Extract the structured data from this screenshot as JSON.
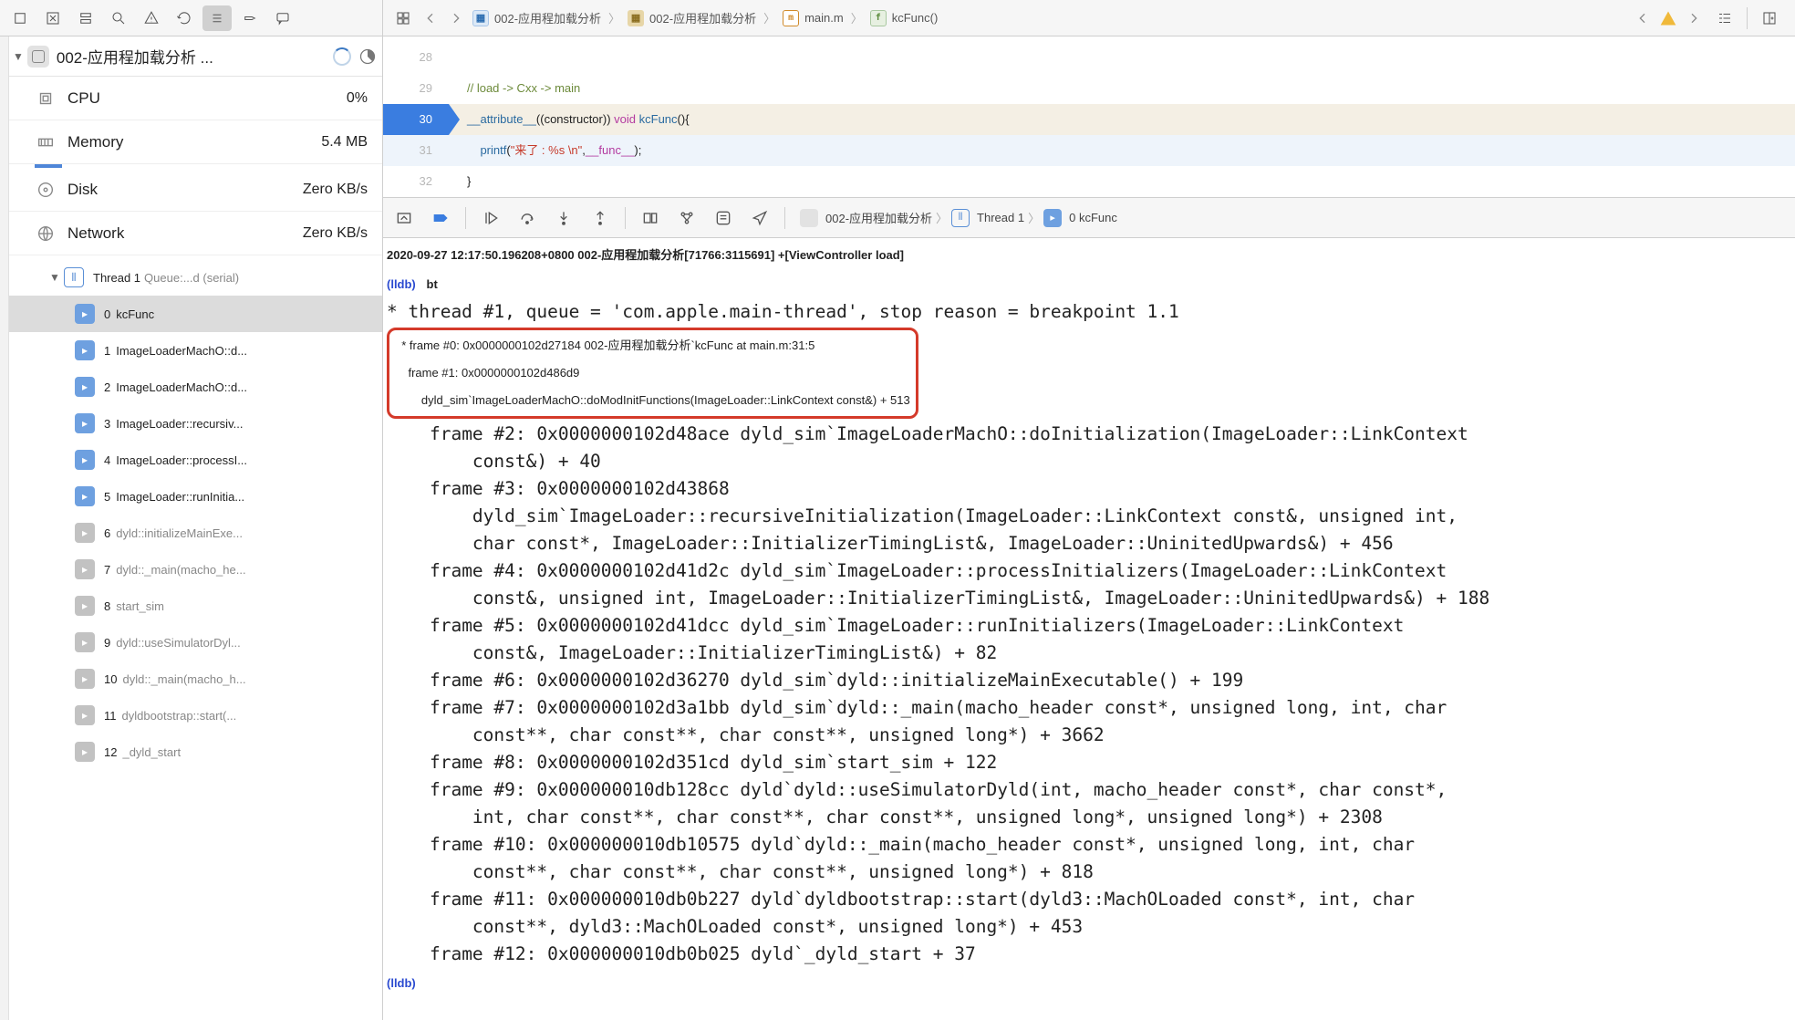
{
  "toolbar_left_icons": [
    "square-icon",
    "x-box-icon",
    "stack-icon",
    "search-icon",
    "warning-icon",
    "refresh-icon",
    "list-icon",
    "tag-icon",
    "chat-icon"
  ],
  "breadcrumbs": [
    {
      "icon": "blue",
      "label": "002-应用程加载分析"
    },
    {
      "icon": "folder",
      "label": "002-应用程加载分析"
    },
    {
      "icon": "m",
      "label": "main.m"
    },
    {
      "icon": "f",
      "label": "kcFunc()"
    }
  ],
  "project": {
    "title": "002-应用程加载分析 ..."
  },
  "metrics": [
    {
      "name": "CPU",
      "value": "0%",
      "icon": "cpu"
    },
    {
      "name": "Memory",
      "value": "5.4 MB",
      "icon": "memory",
      "bar_color": "#4f86d8",
      "bar_pct": 8
    },
    {
      "name": "Disk",
      "value": "Zero KB/s",
      "icon": "disk"
    },
    {
      "name": "Network",
      "value": "Zero KB/s",
      "icon": "network"
    }
  ],
  "thread": {
    "label": "Thread 1",
    "tail": "Queue:...d (serial)"
  },
  "frames": [
    {
      "n": "0",
      "label": "kcFunc",
      "dim": false,
      "selected": true
    },
    {
      "n": "1",
      "label": "ImageLoaderMachO::d...",
      "dim": false
    },
    {
      "n": "2",
      "label": "ImageLoaderMachO::d...",
      "dim": false
    },
    {
      "n": "3",
      "label": "ImageLoader::recursiv...",
      "dim": false
    },
    {
      "n": "4",
      "label": "ImageLoader::processI...",
      "dim": false
    },
    {
      "n": "5",
      "label": "ImageLoader::runInitia...",
      "dim": false
    },
    {
      "n": "6",
      "label": "dyld::initializeMainExe...",
      "dim": true
    },
    {
      "n": "7",
      "label": "dyld::_main(macho_he...",
      "dim": true
    },
    {
      "n": "8",
      "label": "start_sim",
      "dim": true
    },
    {
      "n": "9",
      "label": "dyld::useSimulatorDyl...",
      "dim": true
    },
    {
      "n": "10",
      "label": "dyld::_main(macho_h...",
      "dim": true
    },
    {
      "n": "11",
      "label": "dyldbootstrap::start(...",
      "dim": true
    },
    {
      "n": "12",
      "label": "_dyld_start",
      "dim": true
    }
  ],
  "code": {
    "lines": [
      {
        "n": "28",
        "raw": ""
      },
      {
        "n": "29",
        "comment": "// load -> Cxx -> main"
      },
      {
        "n": "30",
        "hl": true,
        "parts": [
          "__attribute__",
          "((constructor)) ",
          "void",
          " ",
          "kcFunc",
          "(){"
        ]
      },
      {
        "n": "31",
        "active": true,
        "parts_printf": [
          "printf",
          "(",
          "\"来了 : %s \\n\"",
          ",",
          "__func__",
          ");"
        ]
      },
      {
        "n": "32",
        "raw": "}"
      }
    ]
  },
  "dbgcrumbs": [
    {
      "icon": "app",
      "label": "002-应用程加载分析"
    },
    {
      "icon": "th",
      "label": "Thread 1"
    },
    {
      "icon": "fr",
      "label": "0 kcFunc"
    }
  ],
  "console": {
    "ts_line": "2020-09-27 12:17:50.196208+0800 002-应用程加载分析[71766:3115691] +[ViewController load]",
    "prompt": "(lldb)",
    "cmd": "bt",
    "thread_line": "* thread #1, queue = 'com.apple.main-thread', stop reason = breakpoint 1.1",
    "boxed": [
      "  * frame #0: 0x0000000102d27184 002-应用程加载分析`kcFunc at main.m:31:5",
      "    frame #1: 0x0000000102d486d9",
      "        dyld_sim`ImageLoaderMachO::doModInitFunctions(ImageLoader::LinkContext const&) + 513"
    ],
    "rest": [
      "    frame #2: 0x0000000102d48ace dyld_sim`ImageLoaderMachO::doInitialization(ImageLoader::LinkContext",
      "        const&) + 40",
      "    frame #3: 0x0000000102d43868",
      "        dyld_sim`ImageLoader::recursiveInitialization(ImageLoader::LinkContext const&, unsigned int,",
      "        char const*, ImageLoader::InitializerTimingList&, ImageLoader::UninitedUpwards&) + 456",
      "    frame #4: 0x0000000102d41d2c dyld_sim`ImageLoader::processInitializers(ImageLoader::LinkContext",
      "        const&, unsigned int, ImageLoader::InitializerTimingList&, ImageLoader::UninitedUpwards&) + 188",
      "    frame #5: 0x0000000102d41dcc dyld_sim`ImageLoader::runInitializers(ImageLoader::LinkContext",
      "        const&, ImageLoader::InitializerTimingList&) + 82",
      "    frame #6: 0x0000000102d36270 dyld_sim`dyld::initializeMainExecutable() + 199",
      "    frame #7: 0x0000000102d3a1bb dyld_sim`dyld::_main(macho_header const*, unsigned long, int, char",
      "        const**, char const**, char const**, unsigned long*) + 3662",
      "    frame #8: 0x0000000102d351cd dyld_sim`start_sim + 122",
      "    frame #9: 0x000000010db128cc dyld`dyld::useSimulatorDyld(int, macho_header const*, char const*,",
      "        int, char const**, char const**, char const**, unsigned long*, unsigned long*) + 2308",
      "    frame #10: 0x000000010db10575 dyld`dyld::_main(macho_header const*, unsigned long, int, char",
      "        const**, char const**, char const**, unsigned long*) + 818",
      "    frame #11: 0x000000010db0b227 dyld`dyldbootstrap::start(dyld3::MachOLoaded const*, int, char",
      "        const**, dyld3::MachOLoaded const*, unsigned long*) + 453",
      "    frame #12: 0x000000010db0b025 dyld`_dyld_start + 37"
    ],
    "prompt2": "(lldb)"
  }
}
